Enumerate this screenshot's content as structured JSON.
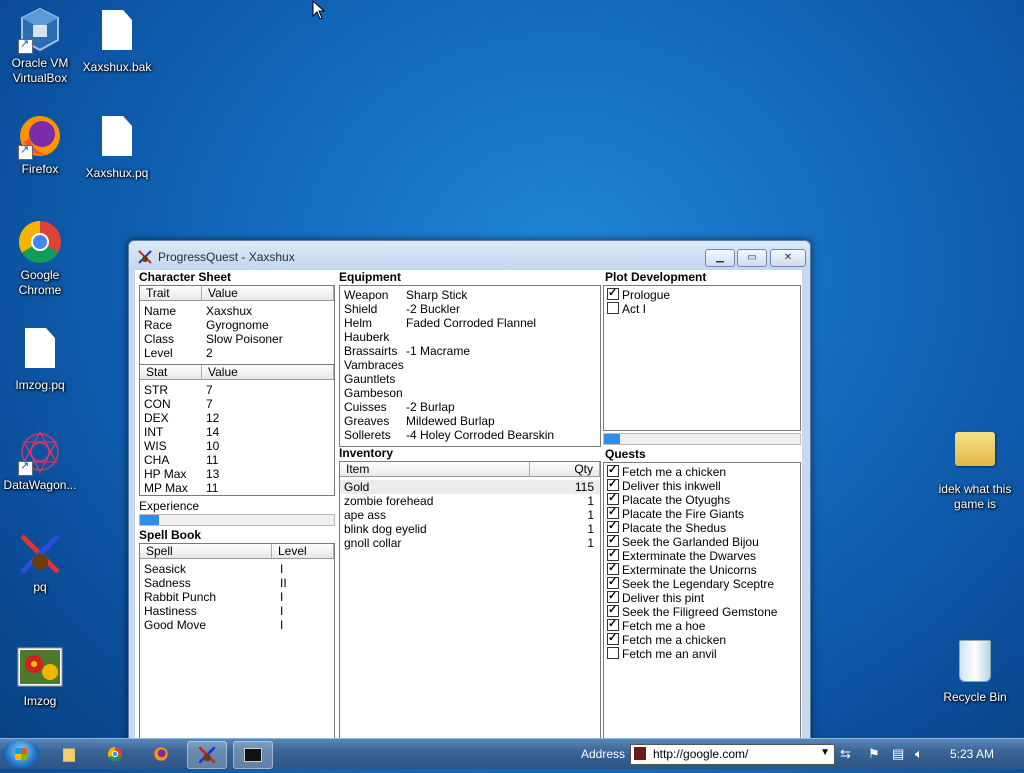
{
  "desktop": {
    "icons": [
      {
        "label": "Oracle VM VirtualBox"
      },
      {
        "label": "Xaxshux.bak"
      },
      {
        "label": "Firefox"
      },
      {
        "label": "Xaxshux.pq"
      },
      {
        "label": "Google Chrome"
      },
      {
        "label": "Imzog.pq"
      },
      {
        "label": "DataWagon..."
      },
      {
        "label": "pq"
      },
      {
        "label": "Imzog"
      },
      {
        "label": "idek what this game is"
      },
      {
        "label": "Recycle Bin"
      }
    ]
  },
  "window": {
    "title": "ProgressQuest - Xaxshux",
    "character_sheet": {
      "header": "Character Sheet",
      "trait_col": "Trait",
      "value_col": "Value",
      "traits": [
        {
          "k": "Name",
          "v": "Xaxshux"
        },
        {
          "k": "Race",
          "v": "Gyrognome"
        },
        {
          "k": "Class",
          "v": "Slow Poisoner"
        },
        {
          "k": "Level",
          "v": "2"
        }
      ],
      "stat_col": "Stat",
      "stat_value_col": "Value",
      "stats": [
        {
          "k": "STR",
          "v": "7"
        },
        {
          "k": "CON",
          "v": "7"
        },
        {
          "k": "DEX",
          "v": "12"
        },
        {
          "k": "INT",
          "v": "14"
        },
        {
          "k": "WIS",
          "v": "10"
        },
        {
          "k": "CHA",
          "v": "11"
        },
        {
          "k": "HP Max",
          "v": "13"
        },
        {
          "k": "MP Max",
          "v": "11"
        }
      ],
      "experience_label": "Experience",
      "experience_progress": 0.1
    },
    "spell_book": {
      "header": "Spell Book",
      "spell_col": "Spell",
      "level_col": "Level",
      "spells": [
        {
          "k": "Seasick",
          "v": "I"
        },
        {
          "k": "Sadness",
          "v": "II"
        },
        {
          "k": "Rabbit Punch",
          "v": "I"
        },
        {
          "k": "Hastiness",
          "v": "I"
        },
        {
          "k": "Good Move",
          "v": "I"
        }
      ]
    },
    "equipment": {
      "header": "Equipment",
      "items": [
        {
          "k": "Weapon",
          "v": "Sharp Stick"
        },
        {
          "k": "Shield",
          "v": "-2 Buckler"
        },
        {
          "k": "Helm",
          "v": "Faded Corroded Flannel"
        },
        {
          "k": "Hauberk",
          "v": ""
        },
        {
          "k": "Brassairts",
          "v": "-1 Macrame"
        },
        {
          "k": "Vambraces",
          "v": ""
        },
        {
          "k": "Gauntlets",
          "v": ""
        },
        {
          "k": "Gambeson",
          "v": ""
        },
        {
          "k": "Cuisses",
          "v": "-2 Burlap"
        },
        {
          "k": "Greaves",
          "v": "Mildewed Burlap"
        },
        {
          "k": "Sollerets",
          "v": "-4 Holey Corroded Bearskin"
        }
      ]
    },
    "inventory": {
      "header": "Inventory",
      "item_col": "Item",
      "qty_col": "Qty",
      "items": [
        {
          "k": "Gold",
          "v": "115"
        },
        {
          "k": "zombie forehead",
          "v": "1"
        },
        {
          "k": "ape ass",
          "v": "1"
        },
        {
          "k": "blink dog eyelid",
          "v": "1"
        },
        {
          "k": "gnoll collar",
          "v": "1"
        }
      ]
    },
    "plot": {
      "header": "Plot Development",
      "acts": [
        {
          "label": "Prologue",
          "done": true
        },
        {
          "label": "Act I",
          "done": false
        }
      ],
      "progress": 0.08
    },
    "quests": {
      "header": "Quests",
      "items": [
        {
          "label": "Fetch me a chicken",
          "done": true
        },
        {
          "label": "Deliver this inkwell",
          "done": true
        },
        {
          "label": "Placate the Otyughs",
          "done": true
        },
        {
          "label": "Placate the Fire Giants",
          "done": true
        },
        {
          "label": "Placate the Shedus",
          "done": true
        },
        {
          "label": "Seek the Garlanded Bijou",
          "done": true
        },
        {
          "label": "Exterminate the Dwarves",
          "done": true
        },
        {
          "label": "Exterminate the Unicorns",
          "done": true
        },
        {
          "label": "Seek the Legendary Sceptre",
          "done": true
        },
        {
          "label": "Deliver this pint",
          "done": true
        },
        {
          "label": "Seek the Filigreed Gemstone",
          "done": true
        },
        {
          "label": "Fetch me a hoe",
          "done": true
        },
        {
          "label": "Fetch me a chicken",
          "done": true
        },
        {
          "label": "Fetch me an anvil",
          "done": false
        }
      ]
    }
  },
  "taskbar": {
    "address_label": "Address",
    "address_url": "http://google.com/",
    "clock": "5:23 AM"
  },
  "icons": {
    "start": "windows-start-icon",
    "explorer": "folder-icon",
    "chrome": "chrome-icon",
    "firefox": "firefox-icon",
    "pq": "progressquest-icon",
    "cmd": "console-icon"
  }
}
